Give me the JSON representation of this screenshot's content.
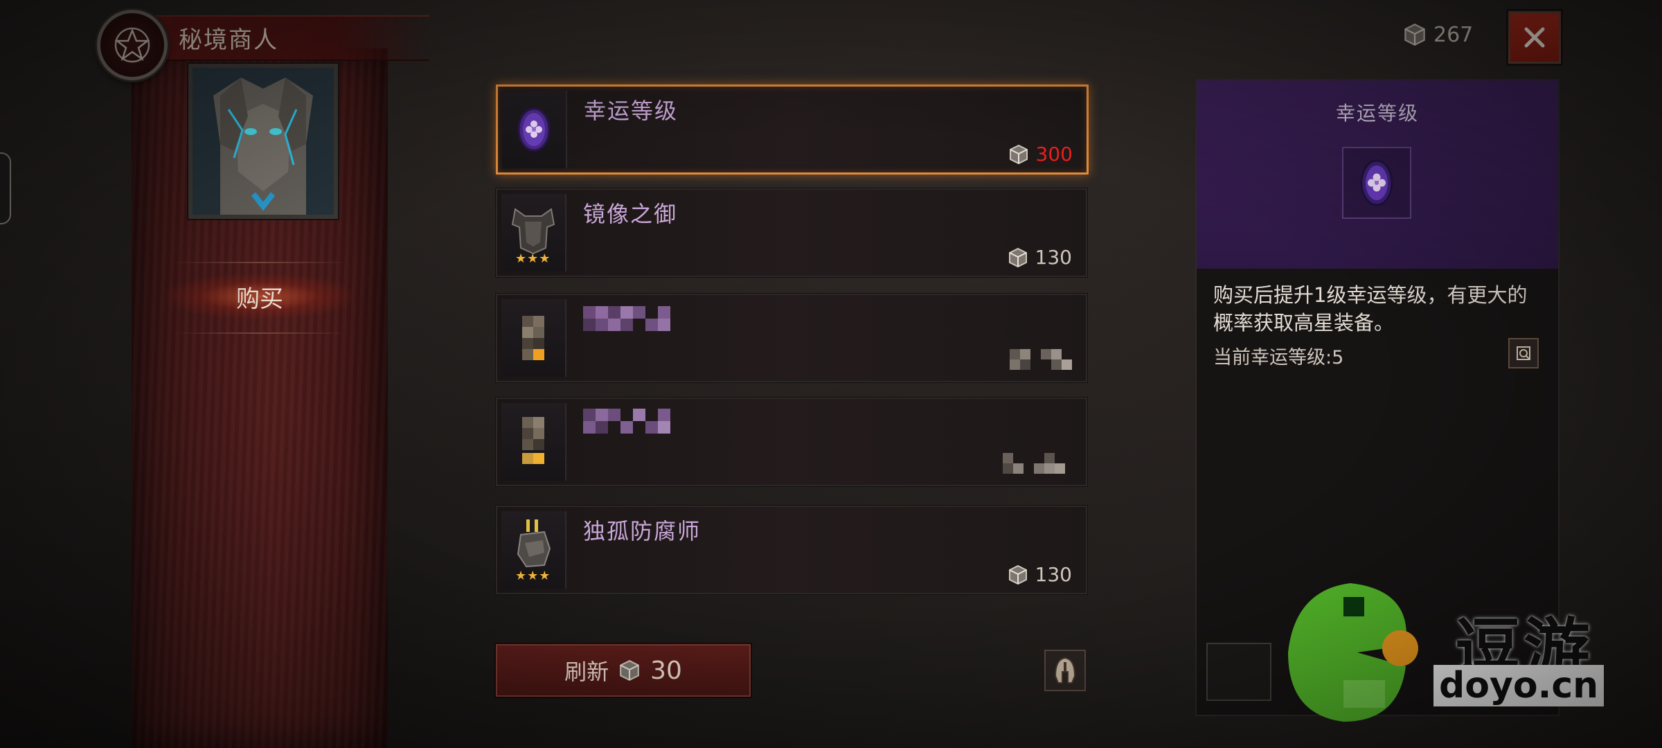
{
  "merchant": {
    "title": "秘境商人",
    "tab_buy": "购买"
  },
  "currency": {
    "icon": "crate-icon",
    "amount": "267"
  },
  "items": [
    {
      "name": "幸运等级",
      "price": "300",
      "stars": "",
      "price_color": "#e8201e",
      "selected": true,
      "icon": "purple-gem-icon"
    },
    {
      "name": "镜像之御",
      "price": "130",
      "stars": "★★★",
      "selected": false,
      "icon": "armor-chest-icon"
    },
    {
      "name": "",
      "price": "",
      "stars": "",
      "selected": false,
      "icon": "pixelated-item-icon"
    },
    {
      "name": "",
      "price": "",
      "stars": "",
      "selected": false,
      "icon": "pixelated-item-icon"
    },
    {
      "name": "独孤防腐师",
      "price": "130",
      "stars": "★★★",
      "selected": false,
      "icon": "gauntlet-icon"
    }
  ],
  "refresh": {
    "label": "刷新",
    "cost": "30"
  },
  "detail": {
    "title": "幸运等级",
    "description": "购买后提升1级幸运等级，有更大的概率获取高星装备。",
    "current_level": "当前幸运等级:5"
  },
  "watermark": {
    "text": "逗游",
    "subtext": "doyo.cn"
  },
  "colors": {
    "accent_orange": "#e08a3a",
    "price_red": "#e8201e",
    "item_name_purple": "#c9a7d8",
    "banner_red": "#521d1c",
    "detail_purple": "#3a1f56"
  }
}
